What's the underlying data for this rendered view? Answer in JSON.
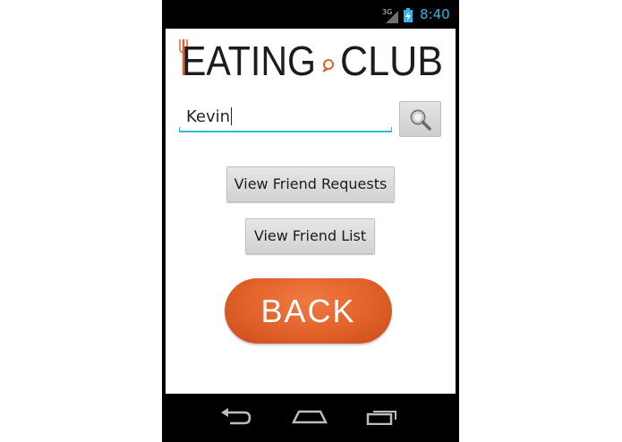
{
  "status_bar": {
    "network": "3G",
    "time": "8:40",
    "accent_color": "#33b5e5"
  },
  "app": {
    "logo_text_left": "EATING",
    "logo_text_right": "CLUB",
    "brand_color": "#e2612a"
  },
  "search": {
    "value": "Kevin",
    "icon": "magnifier-icon"
  },
  "buttons": {
    "friend_requests": "View Friend Requests",
    "friend_list": "View Friend List",
    "back": "BACK"
  },
  "nav_bar": {
    "icons": [
      "back-arrow-icon",
      "home-icon",
      "recent-apps-icon"
    ]
  }
}
